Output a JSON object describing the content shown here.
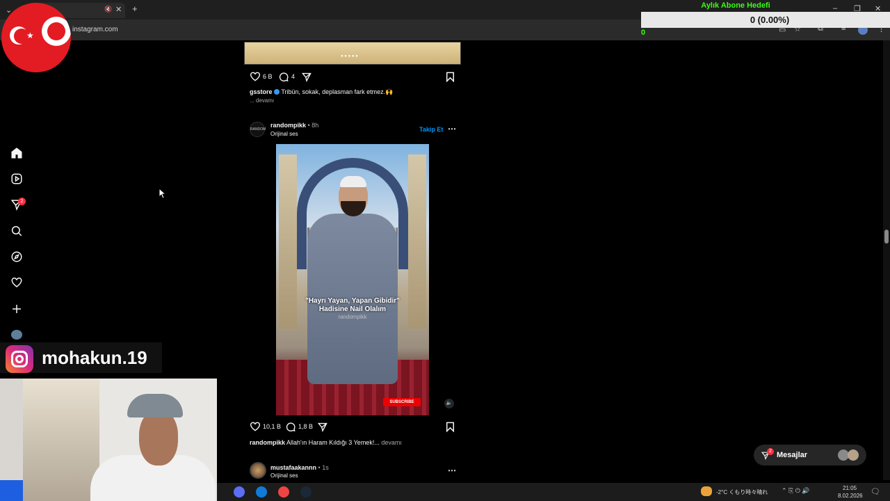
{
  "browser": {
    "url": "instagram.com",
    "tab_close": "✕",
    "tab_add": "+"
  },
  "goal": {
    "title": "Aylık Abone Hedefi",
    "value": "0 (0.00%)",
    "count": "0",
    "progress": 0
  },
  "sidebar": {
    "items": [
      {
        "icon": "home-icon"
      },
      {
        "icon": "reels-icon"
      },
      {
        "icon": "direct-icon",
        "badge": "2"
      },
      {
        "icon": "search-icon"
      },
      {
        "icon": "explore-icon"
      },
      {
        "icon": "heart-icon"
      },
      {
        "icon": "create-icon"
      }
    ]
  },
  "post1": {
    "likes": "6 B",
    "comments": "4",
    "username": "gsstore",
    "caption": "Tribün, sokak, deplasman fark etmez.🙌",
    "more": "... devamı"
  },
  "post2": {
    "username": "randompikk",
    "dot": "•",
    "time": "8h",
    "audio": "Orijinal ses",
    "follow": "Takip Et",
    "avatar_text": "RANDOM",
    "video_caption_line1": "\"Hayrı Yayan, Yapan Gibidir\"",
    "video_caption_line2": "Hadisine Nail Olalım",
    "watermark": "randompikk",
    "subscribe": "SUBSCRIBE",
    "likes": "10,1 B",
    "comments": "1,8 B",
    "caption_user": "randompikk",
    "caption": "Allah'ın Haram Kıldığı 3 Yemek!...",
    "more": "devamı"
  },
  "post3": {
    "username": "mustafaakannn",
    "dot": "•",
    "time": "1s",
    "audio": "Orijinal ses"
  },
  "overlay": {
    "handle": "mohakun.19"
  },
  "messages": {
    "label": "Mesajlar",
    "badge": "2"
  },
  "taskbar": {
    "weather": "-2°C くもり時々晴れ",
    "time": "21:05",
    "date": "8.02.2026"
  }
}
